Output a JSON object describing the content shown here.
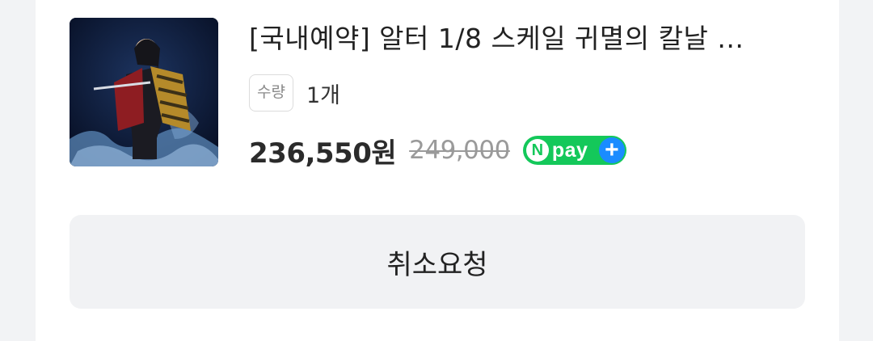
{
  "product": {
    "title": "[국내예약] 알터 1/8 스케일 귀멸의 칼날 ...",
    "quantity_label": "수량",
    "quantity_value": "1개",
    "price": "236,550원",
    "original_price": "249,000"
  },
  "npay": {
    "n": "N",
    "text": "pay",
    "plus": "+"
  },
  "actions": {
    "cancel_label": "취소요청"
  }
}
